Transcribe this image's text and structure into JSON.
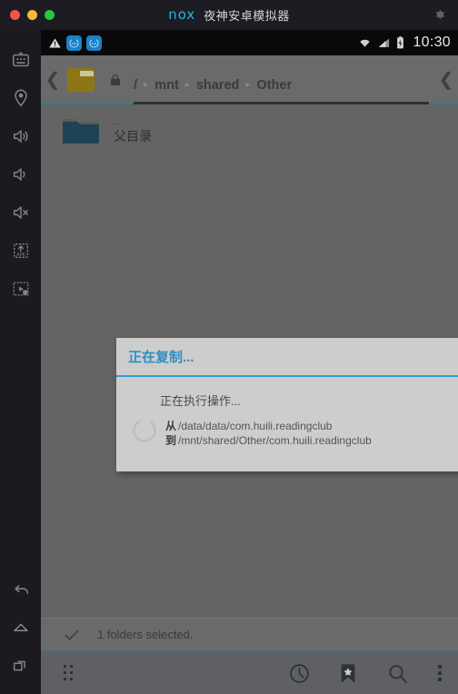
{
  "window": {
    "app_title": "夜神安卓模拟器",
    "logo_text": "nox",
    "settings_icon": "gear-icon",
    "traffic_lights": [
      "close",
      "minimize",
      "maximize"
    ]
  },
  "sidebar": {
    "top_items": [
      {
        "name": "keyboard-icon",
        "label": "Keyboard"
      },
      {
        "name": "location-icon",
        "label": "Location"
      },
      {
        "name": "volume-up-icon",
        "label": "Volume Up"
      },
      {
        "name": "volume-down-icon",
        "label": "Volume Down"
      },
      {
        "name": "volume-mute-icon",
        "label": "Mute"
      },
      {
        "name": "apk-install-icon",
        "label": "Install APK"
      },
      {
        "name": "screen-record-icon",
        "label": "Screen Record"
      }
    ],
    "bottom_items": [
      {
        "name": "back-icon",
        "label": "Back"
      },
      {
        "name": "home-icon",
        "label": "Home"
      },
      {
        "name": "recents-icon",
        "label": "Recents"
      }
    ]
  },
  "status_bar": {
    "warning_icon": "warning-triangle-icon",
    "notification_icons": [
      "nox-notification-icon",
      "nox-notification-icon"
    ],
    "wifi_icon": "wifi-icon",
    "signal_icon": "cellular-signal-icon",
    "battery_icon": "battery-charging-icon",
    "clock": "10:30"
  },
  "action_bar": {
    "back_chevron": "chevron-left-icon",
    "folder_icon": "folder-tab-icon",
    "lock_icon": "lock-icon",
    "breadcrumbs": [
      {
        "label": "/",
        "root": true
      },
      {
        "label": "mnt",
        "root": false
      },
      {
        "label": "shared",
        "root": false
      },
      {
        "label": "Other",
        "root": false
      }
    ],
    "separator": "▸",
    "forward_chevron": "chevron-right-icon"
  },
  "file_list": {
    "rows": [
      {
        "icon": "folder-icon",
        "sub": "..",
        "name": "父目录"
      }
    ]
  },
  "selection_bar": {
    "check_icon": "checkmark-icon",
    "text": "1 folders selected."
  },
  "bottom_toolbar": {
    "items": [
      {
        "name": "drawer-grid-icon",
        "label": "Drawer"
      },
      {
        "name": "history-clock-icon",
        "label": "History"
      },
      {
        "name": "bookmark-icon",
        "label": "Bookmarks"
      },
      {
        "name": "search-icon",
        "label": "Search"
      },
      {
        "name": "overflow-menu-icon",
        "label": "More options"
      }
    ]
  },
  "dialog": {
    "title": "正在复制...",
    "status": "正在执行操作...",
    "spinner_icon": "loading-spinner-icon",
    "paths": [
      {
        "label": "从",
        "value": "/data/data/com.huili.readingclub"
      },
      {
        "label": "到",
        "value": "/mnt/shared/Other/com.huili.readingclub"
      }
    ]
  },
  "colors": {
    "accent_blue": "#2e8fc4",
    "divider_teal": "#3f7183",
    "nox_cyan": "#21b7e0",
    "screen_bg": "#646464",
    "dialog_bg": "#cdcdcd"
  }
}
